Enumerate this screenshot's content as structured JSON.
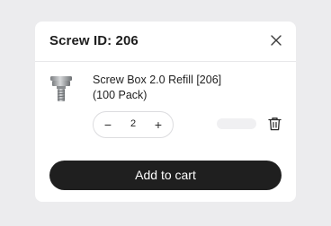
{
  "header": {
    "title": "Screw ID: 206"
  },
  "product": {
    "name_line1": "Screw Box 2.0 Refill [206]",
    "name_line2": "(100 Pack)",
    "quantity": "2",
    "minus_label": "−",
    "plus_label": "+",
    "thumbnail_icon": "screw-icon"
  },
  "actions": {
    "add_to_cart_label": "Add to cart"
  },
  "icons": {
    "close": "close-icon",
    "delete": "trash-icon"
  },
  "colors": {
    "background": "#ececee",
    "card": "#ffffff",
    "button": "#1f1f1f",
    "button_text": "#ffffff"
  }
}
